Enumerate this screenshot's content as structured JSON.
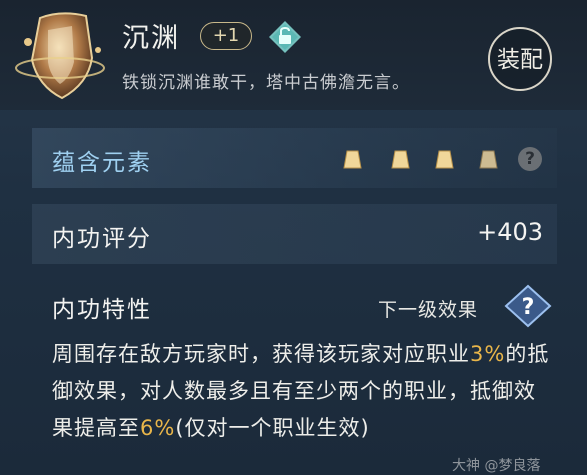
{
  "header": {
    "title": "沉渊",
    "level_badge": "+1",
    "subtitle": "铁锁沉渊谁敢干，塔中古佛澹无言。",
    "equip_label": "装配"
  },
  "elements": {
    "label": "蕴含元素",
    "help": "?"
  },
  "score": {
    "label": "内功评分",
    "value": "+403"
  },
  "traits": {
    "label": "内功特性",
    "next_level": "下一级效果",
    "desc_part1": "周围存在敌方玩家时，获得该玩家对应职业",
    "pct1": "3%",
    "desc_part2": "的抵御效果，对人数最多且有至少两个的职业，抵御效果提高至",
    "pct2": "6%",
    "desc_part3": "(仅对一个职业生效)"
  },
  "watermark": "大神 @梦良落",
  "colors": {
    "highlight": "#e9b64a",
    "element_label": "#9fd0f0",
    "background": "#1f3042"
  }
}
